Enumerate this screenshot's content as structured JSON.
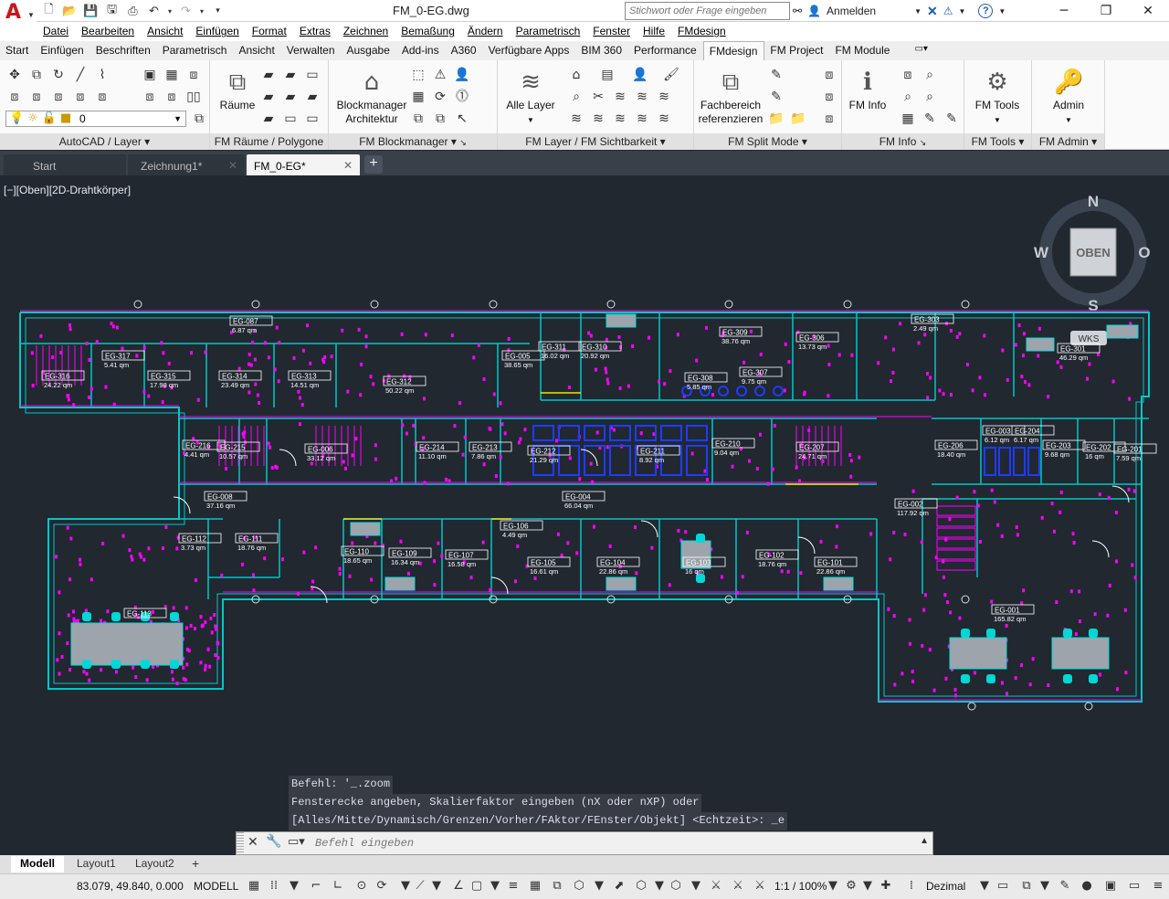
{
  "title_bar": {
    "document_title": "FM_0-EG.dwg",
    "search_placeholder": "Stichwort oder Frage eingeben",
    "signin_label": "Anmelden",
    "help_icon": "question-icon",
    "qat_icons": [
      "new-icon",
      "open-icon",
      "save-icon",
      "saveas-icon",
      "print-icon",
      "undo-icon",
      "redo-icon",
      "more-icon"
    ]
  },
  "menu": [
    "Datei",
    "Bearbeiten",
    "Ansicht",
    "Einfügen",
    "Format",
    "Extras",
    "Zeichnen",
    "Bemaßung",
    "Ändern",
    "Parametrisch",
    "Fenster",
    "Hilfe",
    "FMdesign"
  ],
  "ribbon_tabs": [
    "Start",
    "Einfügen",
    "Beschriften",
    "Parametrisch",
    "Ansicht",
    "Verwalten",
    "Ausgabe",
    "Add-ins",
    "A360",
    "Verfügbare Apps",
    "BIM 360",
    "Performance",
    "FMdesign",
    "FM Project",
    "FM Module"
  ],
  "active_ribbon_tab": "FMdesign",
  "ribbon": {
    "layer_combo_value": "0",
    "panels": {
      "autocad_layer": "AutoCAD / Layer",
      "fm_raeume": "FM Räume / Polygone",
      "fm_blockmanager": "FM Blockmanager",
      "fm_layer": "FM Layer / FM Sichtbarkeit",
      "fm_split": "FM Split Mode",
      "fm_info": "FM Info",
      "fm_tools": "FM Tools",
      "fm_admin": "FM Admin"
    },
    "buttons": {
      "raeume": "Räume",
      "blockmanager_1": "Blockmanager",
      "blockmanager_2": "Architektur",
      "alle_layer": "Alle Layer",
      "fachbereich_1": "Fachbereich",
      "fachbereich_2": "referenzieren",
      "fm_info": "FM Info",
      "fm_tools": "FM Tools",
      "admin": "Admin"
    }
  },
  "file_tabs": [
    {
      "label": "Start",
      "active": false,
      "closable": false
    },
    {
      "label": "Zeichnung1*",
      "active": false,
      "closable": true
    },
    {
      "label": "FM_0-EG*",
      "active": true,
      "closable": true
    }
  ],
  "viewport": {
    "view_label": "[−][Oben][2D-Drahtkörper]",
    "viewcube": {
      "top": "OBEN",
      "n": "N",
      "s": "S",
      "w": "W",
      "o": "O",
      "wcs": "WKS"
    }
  },
  "rooms": [
    {
      "id": "EG-087",
      "area": "6.87 qm"
    },
    {
      "id": "EG-317",
      "area": "5.41 qm"
    },
    {
      "id": "EG-316",
      "area": "24.22 qm"
    },
    {
      "id": "EG-315",
      "area": "17.98 qm"
    },
    {
      "id": "EG-314",
      "area": "23.49 qm"
    },
    {
      "id": "EG-313",
      "area": "14.51 qm"
    },
    {
      "id": "EG-312",
      "area": "50.22 qm"
    },
    {
      "id": "EG-005",
      "area": "38.65 qm"
    },
    {
      "id": "EG-311",
      "area": "16.02 qm"
    },
    {
      "id": "EG-310",
      "area": "20.92 qm"
    },
    {
      "id": "EG-309",
      "area": "38.76 qm"
    },
    {
      "id": "EG-308",
      "area": "5.85 qm"
    },
    {
      "id": "EG-307",
      "area": "9.75 qm"
    },
    {
      "id": "EG-306",
      "area": "13.73 qm"
    },
    {
      "id": "EG-303",
      "area": "2.49 qm"
    },
    {
      "id": "EG-301",
      "area": "46.29 qm"
    },
    {
      "id": "EG-216",
      "area": "4.41 qm"
    },
    {
      "id": "EG-215",
      "area": "10.57 qm"
    },
    {
      "id": "EG-006",
      "area": "33.12 qm"
    },
    {
      "id": "EG-214",
      "area": "11.10 qm"
    },
    {
      "id": "EG-213",
      "area": "7.86 qm"
    },
    {
      "id": "EG-212",
      "area": "21.29 qm"
    },
    {
      "id": "EG-211",
      "area": "8.92 qm"
    },
    {
      "id": "EG-210",
      "area": "9.04 qm"
    },
    {
      "id": "EG-207",
      "area": "24.71 qm"
    },
    {
      "id": "EG-206",
      "area": "18.40 qm"
    },
    {
      "id": "EG-003",
      "area": "6.12 qm"
    },
    {
      "id": "EG-204",
      "area": "6.17 qm"
    },
    {
      "id": "EG-203",
      "area": "9.68 qm"
    },
    {
      "id": "EG-202",
      "area": "16 qm"
    },
    {
      "id": "EG-201",
      "area": "7.59 qm"
    },
    {
      "id": "EG-008",
      "area": "37.16 qm"
    },
    {
      "id": "EG-004",
      "area": "66.04 qm"
    },
    {
      "id": "EG-002",
      "area": "117.92 qm"
    },
    {
      "id": "EG-112",
      "area": "3.73 qm"
    },
    {
      "id": "EG-111",
      "area": "18.76 qm"
    },
    {
      "id": "EG-110",
      "area": "18.65 qm"
    },
    {
      "id": "EG-109",
      "area": "16.34 qm"
    },
    {
      "id": "EG-107",
      "area": "16.58 qm"
    },
    {
      "id": "EG-106",
      "area": "4.49 qm"
    },
    {
      "id": "EG-105",
      "area": "16.61 qm"
    },
    {
      "id": "EG-104",
      "area": "22.86 qm"
    },
    {
      "id": "EG-103",
      "area": "16 qm"
    },
    {
      "id": "EG-102",
      "area": "18.76 qm"
    },
    {
      "id": "EG-101",
      "area": "22.86 qm"
    },
    {
      "id": "EG-113",
      "area": ""
    },
    {
      "id": "EG-001",
      "area": "165.82 qm"
    }
  ],
  "command": {
    "history": [
      "Befehl: '_.zoom",
      "Fensterecke angeben, Skalierfaktor eingeben (nX oder nXP) oder",
      "[Alles/Mitte/Dynamisch/Grenzen/Vorher/FAktor/FEnster/Objekt] <Echtzeit>: _e"
    ],
    "input_placeholder": "Befehl eingeben"
  },
  "layout_tabs": [
    {
      "label": "Modell",
      "active": true
    },
    {
      "label": "Layout1",
      "active": false
    },
    {
      "label": "Layout2",
      "active": false
    }
  ],
  "status_bar": {
    "coordinates": "83.079, 49.840, 0.000",
    "space": "MODELL",
    "scale": "1:1 / 100%",
    "units": "Dezimal"
  },
  "colors": {
    "canvas": "#212830",
    "walls": "#00c8c8",
    "magenta": "#ff00ff",
    "label_text": "#ffffff",
    "blue_fixtures": "#1e3cff"
  }
}
